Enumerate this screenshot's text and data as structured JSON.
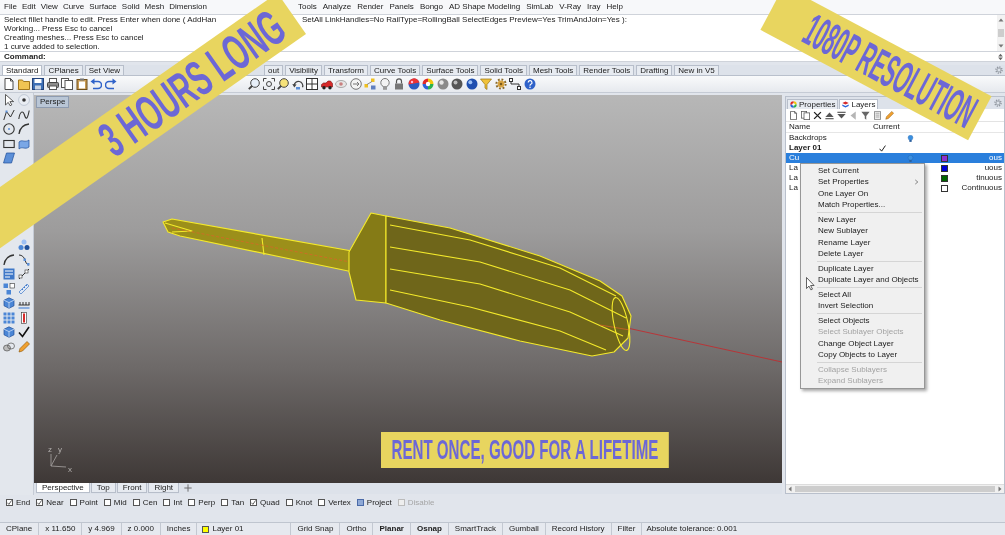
{
  "menu_bar": {
    "groups": [
      [
        "File",
        "Edit",
        "View",
        "Curve",
        "Surface",
        "Solid",
        "Mesh",
        "Dimension"
      ],
      [
        "Tools",
        "Analyze",
        "Render",
        "Panels",
        "Bongo",
        "AD Shape Modeling",
        "SimLab",
        "V-Ray",
        "Iray",
        "Help"
      ]
    ]
  },
  "command_history": {
    "lines": [
      [
        "Select fillet handle to edit. Press Enter when done ( AddHan",
        "SetAll  LinkHandles=No  RailType=RollingBall  SelectEdges  Preview=Yes  TrimAndJoin=Yes ):"
      ],
      [
        "Working... Press Esc to cancel"
      ],
      [
        "Creating meshes... Press Esc to cancel"
      ],
      [
        "1 curve added to selection."
      ]
    ]
  },
  "command_prompt": {
    "label": "Command:"
  },
  "toolbar_tabs": {
    "groups": [
      [
        {
          "label": "Standard",
          "selected": true
        },
        {
          "label": "CPlanes",
          "selected": false
        },
        {
          "label": "Set View",
          "selected": false
        }
      ],
      [
        {
          "label": "out",
          "selected": false
        },
        {
          "label": "Visibility",
          "selected": false
        },
        {
          "label": "Transform",
          "selected": false
        },
        {
          "label": "Curve Tools",
          "selected": false
        },
        {
          "label": "Surface Tools",
          "selected": false
        },
        {
          "label": "Solid Tools",
          "selected": false
        },
        {
          "label": "Mesh Tools",
          "selected": false
        },
        {
          "label": "Render Tools",
          "selected": false
        },
        {
          "label": "Drafting",
          "selected": false
        },
        {
          "label": "New in V5",
          "selected": false
        }
      ]
    ]
  },
  "viewport": {
    "title": "Perspe",
    "axis_labels": [
      "z",
      "y",
      "x"
    ]
  },
  "viewport_tabs": [
    {
      "label": "Perspective",
      "selected": true
    },
    {
      "label": "Top",
      "selected": false
    },
    {
      "label": "Front",
      "selected": false
    },
    {
      "label": "Right",
      "selected": false
    }
  ],
  "side_panel": {
    "tabs": [
      {
        "label": "Properties",
        "selected": false
      },
      {
        "label": "Layers",
        "selected": true
      }
    ],
    "layers": {
      "columns": [
        "Name",
        "Current"
      ],
      "rows": [
        {
          "name": "Backdrops",
          "current": false,
          "selected": false,
          "on": true
        },
        {
          "name": "Layer 01",
          "current": true,
          "selected": false
        },
        {
          "name": "Cu",
          "current": false,
          "selected": true,
          "on": true,
          "color": "#8e2fd0",
          "linetype": "ous"
        },
        {
          "name": "La",
          "current": false,
          "selected": false,
          "color": "#0000d8",
          "linetype": "uous"
        },
        {
          "name": "La",
          "current": false,
          "selected": false,
          "color": "#006400",
          "linetype": "tinuous"
        },
        {
          "name": "La",
          "current": false,
          "selected": false,
          "color": "#ffffff",
          "linetype": "Continuous"
        }
      ]
    },
    "context_menu": {
      "items": [
        {
          "kind": "item",
          "label": "Set Current",
          "disabled": false,
          "has_submenu": false
        },
        {
          "kind": "item",
          "label": "Set Properties",
          "disabled": false,
          "has_submenu": true
        },
        {
          "kind": "item",
          "label": "One Layer On",
          "disabled": false,
          "has_submenu": false
        },
        {
          "kind": "item",
          "label": "Match Properties...",
          "disabled": false,
          "has_submenu": false
        },
        {
          "kind": "separator"
        },
        {
          "kind": "item",
          "label": "New Layer",
          "disabled": false,
          "has_submenu": false
        },
        {
          "kind": "item",
          "label": "New Sublayer",
          "disabled": false,
          "has_submenu": false
        },
        {
          "kind": "item",
          "label": "Rename Layer",
          "disabled": false,
          "has_submenu": false
        },
        {
          "kind": "item",
          "label": "Delete Layer",
          "disabled": false,
          "has_submenu": false
        },
        {
          "kind": "separator"
        },
        {
          "kind": "item",
          "label": "Duplicate Layer",
          "disabled": false,
          "has_submenu": false
        },
        {
          "kind": "item",
          "label": "Duplicate Layer and Objects",
          "disabled": false,
          "has_submenu": false
        },
        {
          "kind": "separator"
        },
        {
          "kind": "item",
          "label": "Select All",
          "disabled": false,
          "has_submenu": false
        },
        {
          "kind": "item",
          "label": "Invert Selection",
          "disabled": false,
          "has_submenu": false
        },
        {
          "kind": "separator"
        },
        {
          "kind": "item",
          "label": "Select Objects",
          "disabled": false,
          "has_submenu": false
        },
        {
          "kind": "item",
          "label": "Select Sublayer Objects",
          "disabled": true,
          "has_submenu": false
        },
        {
          "kind": "item",
          "label": "Change Object Layer",
          "disabled": false,
          "has_submenu": false
        },
        {
          "kind": "item",
          "label": "Copy Objects to Layer",
          "disabled": false,
          "has_submenu": false
        },
        {
          "kind": "separator"
        },
        {
          "kind": "item",
          "label": "Collapse Sublayers",
          "disabled": true,
          "has_submenu": false
        },
        {
          "kind": "item",
          "label": "Expand Sublayers",
          "disabled": true,
          "has_submenu": false
        }
      ]
    }
  },
  "osnaps": [
    {
      "label": "End",
      "kind": "check",
      "checked": true,
      "disabled": false
    },
    {
      "label": "Near",
      "kind": "check",
      "checked": true,
      "disabled": false
    },
    {
      "label": "Point",
      "kind": "check",
      "checked": false,
      "disabled": false
    },
    {
      "label": "Mid",
      "kind": "check",
      "checked": false,
      "disabled": false
    },
    {
      "label": "Cen",
      "kind": "check",
      "checked": false,
      "disabled": false
    },
    {
      "label": "Int",
      "kind": "check",
      "checked": false,
      "disabled": false
    },
    {
      "label": "Perp",
      "kind": "check",
      "checked": false,
      "disabled": false
    },
    {
      "label": "Tan",
      "kind": "check",
      "checked": false,
      "disabled": false
    },
    {
      "label": "Quad",
      "kind": "check",
      "checked": true,
      "disabled": false
    },
    {
      "label": "Knot",
      "kind": "check",
      "checked": false,
      "disabled": false
    },
    {
      "label": "Vertex",
      "kind": "check",
      "checked": false,
      "disabled": false
    },
    {
      "label": "Project",
      "kind": "toggle",
      "checked": true,
      "disabled": false
    },
    {
      "label": "Disable",
      "kind": "toggle",
      "checked": false,
      "disabled": true
    }
  ],
  "status_bar": {
    "cplane": "CPlane",
    "x": "x 11.650",
    "y": "y 4.969",
    "z": "z 0.000",
    "units": "Inches",
    "layer": {
      "name": "Layer 01",
      "color": "#ffff00"
    },
    "toggles": [
      {
        "label": "Grid Snap",
        "on": false
      },
      {
        "label": "Ortho",
        "on": false
      },
      {
        "label": "Planar",
        "on": true
      },
      {
        "label": "Osnap",
        "on": true
      },
      {
        "label": "SmartTrack",
        "on": false
      },
      {
        "label": "Gumball",
        "on": false
      },
      {
        "label": "Record History",
        "on": false
      },
      {
        "label": "Filter",
        "on": false
      }
    ],
    "tolerance": "Absolute tolerance: 0.001"
  },
  "promo_banners": [
    {
      "text": "3 HOURS LONG"
    },
    {
      "text": "1080P RESOLUTION"
    },
    {
      "text": "RENT ONCE, GOOD FOR A LIFETIME"
    }
  ]
}
